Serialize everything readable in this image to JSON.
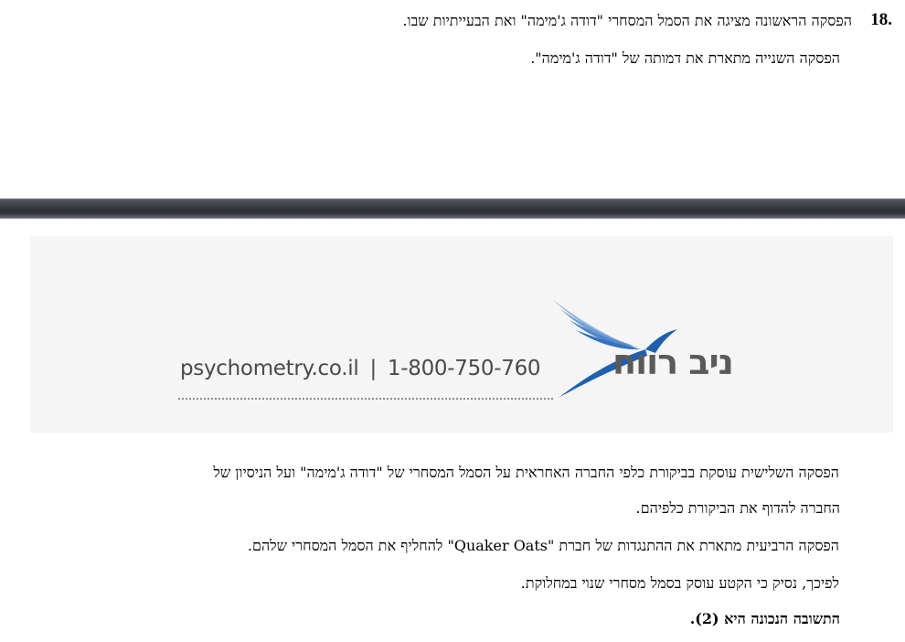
{
  "question": {
    "number": "18.",
    "lines": [
      "הפסקה הראשונה מציגה את הסמל המסחרי \"דודה ג'מימה\" ואת הבעייתיות שבו.",
      "הפסקה השנייה מתארת את דמותה של \"דודה ג'מימה\"."
    ]
  },
  "banner": {
    "website": "psychometry.co.il",
    "separator": "|",
    "phone": "1-800-750-760",
    "brand_name": "ניב רווח",
    "colors": {
      "bird_dark": "#1f5fae",
      "bird_light": "#8fb4e0",
      "text": "#5a5a5a"
    },
    "icon": "bird-logo-icon"
  },
  "continuation": {
    "lines": [
      "הפסקה השלישית עוסקת בביקורת כלפי החברה האחראית על הסמל המסחרי של \"דודה ג'מימה\" ועל הניסיון של",
      "החברה להדוף את הביקורת כלפיהם.",
      "הפסקה הרביעית מתארת את ההתנגדות של חברת \"Quaker Oats\" להחליף את הסמל המסחרי שלהם.",
      "לפיכך, נסיק כי הקטע עוסק בסמל מסחרי שנוי במחלוקת."
    ],
    "answer": "התשובה הנכונה היא (2)."
  }
}
